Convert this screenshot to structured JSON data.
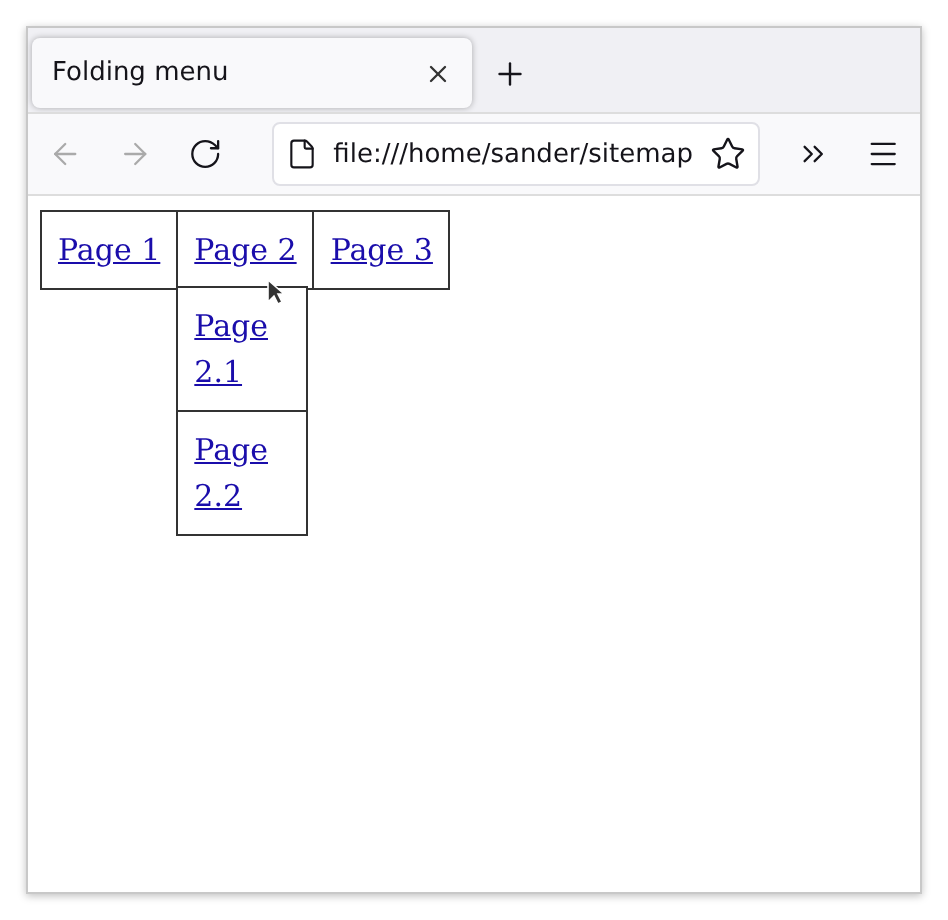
{
  "window": {
    "tab": {
      "title": "Folding menu",
      "selected": true
    },
    "address": "file:///home/sander/sitemap"
  },
  "menu": [
    {
      "label": "Page 1",
      "expanded": false
    },
    {
      "label": "Page 2",
      "expanded": true,
      "children": [
        {
          "label": "Page 2.1"
        },
        {
          "label": "Page 2.2"
        }
      ]
    },
    {
      "label": "Page 3",
      "expanded": false
    }
  ]
}
